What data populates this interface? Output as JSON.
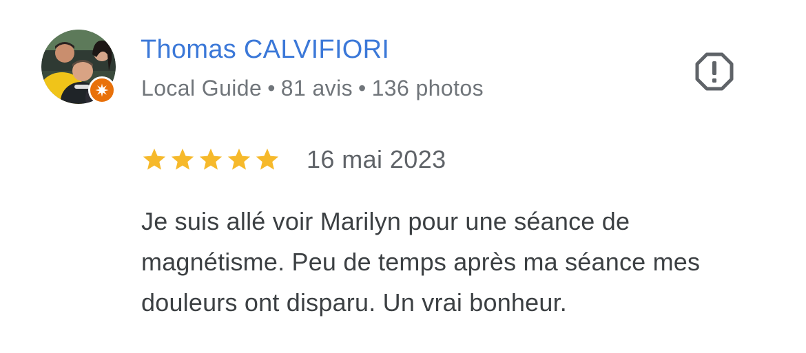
{
  "author": {
    "name": "Thomas CALVIFIORI",
    "level": "Local Guide",
    "reviews_count": "81 avis",
    "photos_count": "136 photos",
    "separator": "•",
    "avatar_icon": "profile-photo",
    "badge_icon": "local-guide-star-icon"
  },
  "review": {
    "rating": 5,
    "rating_max": 5,
    "date": "16 mai 2023",
    "text": "Je suis allé voir Marilyn pour une séance de magnétisme. Peu de temps après ma séance mes douleurs ont disparu. Un vrai bonheur."
  },
  "actions": {
    "report_icon": "report-octagon-icon"
  },
  "colors": {
    "name_link": "#3b78d8",
    "meta_text": "#70757a",
    "star": "#f6b92b",
    "body_text": "#3c4043",
    "badge": "#e8710a",
    "report_icon": "#5f6368"
  }
}
